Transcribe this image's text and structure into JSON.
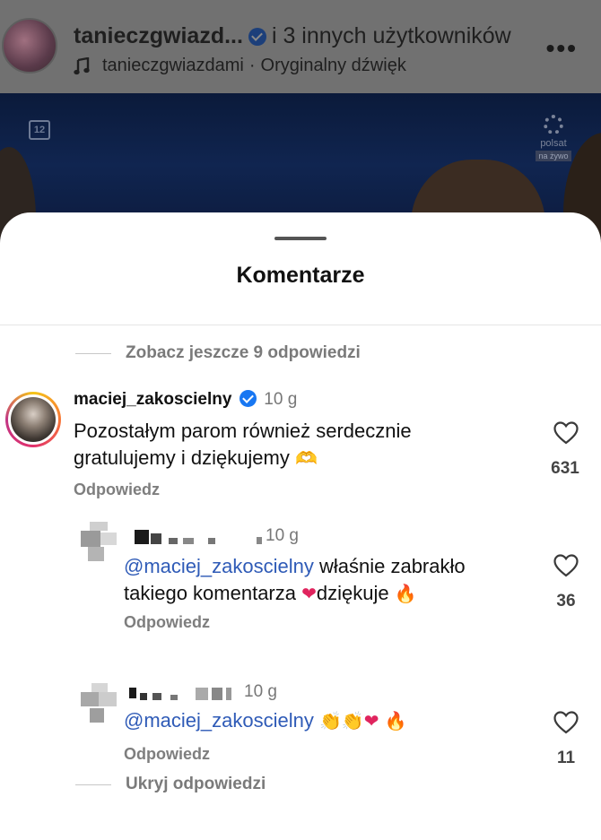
{
  "reel": {
    "author": "tanieczgwiazd...",
    "collab": "i 3 innych użytkowników",
    "audio_user": "tanieczgwiazdami",
    "audio_sep": "·",
    "audio_label": "Oryginalny dźwięk",
    "more": "•••",
    "video_badge": "12",
    "video_logo": "polsat",
    "video_live": "na żywo"
  },
  "sheet": {
    "title": "Komentarze",
    "see_more_replies": "Zobacz jeszcze 9 odpowiedzi",
    "hide_replies": "Ukryj odpowiedzi"
  },
  "comments": [
    {
      "username": "maciej_zakoscielny",
      "verified": true,
      "time": "10 g",
      "text_line1": "Pozostałym parom również serdecznie",
      "text_line2": "gratulujemy i dziękujemy",
      "emoji": "🫶",
      "reply_label": "Odpowiedz",
      "likes": "631"
    },
    {
      "time": "10 g",
      "mention": "@maciej_zakoscielny",
      "text_line1": " właśnie zabrakło",
      "text_line2a": "takiego komentarza ",
      "emoji_heart": "❤",
      "text_line2b": "dziękuje ",
      "emoji_fire": "🔥",
      "reply_label": "Odpowiedz",
      "likes": "36"
    },
    {
      "time": "10 g",
      "mention": "@maciej_zakoscielny",
      "emoji_clap1": "👏",
      "emoji_clap2": "👏",
      "emoji_heart": "❤",
      "emoji_fire": "🔥",
      "reply_label": "Odpowiedz",
      "likes": "11"
    }
  ],
  "colors": {
    "mention": "#2f5bb7",
    "verified": "#1877f2",
    "muted": "#7a7a7a"
  }
}
